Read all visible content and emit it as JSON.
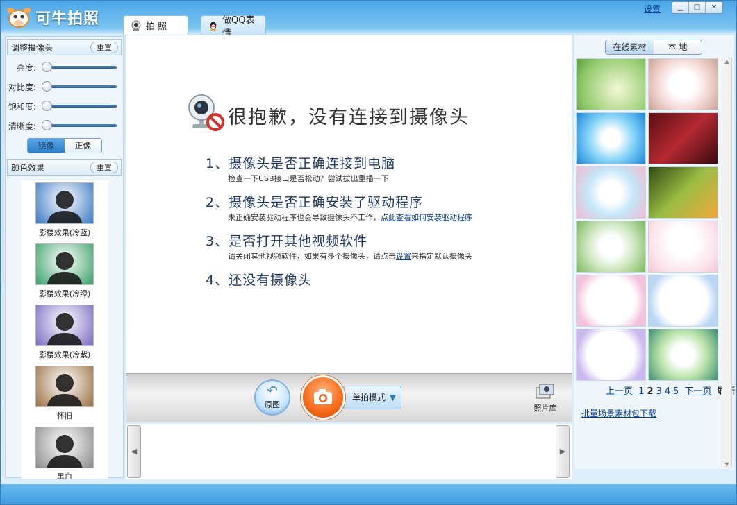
{
  "app": {
    "title": "可牛拍照"
  },
  "tabs": [
    {
      "label": "拍 照"
    },
    {
      "label": "做QQ表情"
    }
  ],
  "header": {
    "settings_link": "设置"
  },
  "camera_panel": {
    "title": "调整摄像头",
    "reset_label": "重置",
    "sliders": [
      {
        "label": "亮度:",
        "level": 0
      },
      {
        "label": "对比度:",
        "level": 0
      },
      {
        "label": "饱和度:",
        "level": 0
      },
      {
        "label": "清晰度:",
        "level": 0
      }
    ],
    "mirror_on": "镜像",
    "mirror_off": "正像"
  },
  "effects_panel": {
    "title": "颜色效果",
    "reset_label": "重置",
    "items": [
      {
        "label": "影楼效果(冷蓝)",
        "color": "#3a79c3"
      },
      {
        "label": "影楼效果(冷绿)",
        "color": "#3aa06a"
      },
      {
        "label": "影楼效果(冷紫)",
        "color": "#7a6bbf"
      },
      {
        "label": "怀旧",
        "color": "#9a7042"
      },
      {
        "label": "黑白",
        "color": "#8c8c8c"
      }
    ]
  },
  "error": {
    "title": "很抱歉，没有连接到摄像头",
    "tips": [
      {
        "head": "1、摄像头是否正确连接到电脑",
        "sub_before": "检查一下USB接口是否松动？尝试拔出重插一下",
        "link": "",
        "sub_after": ""
      },
      {
        "head": "2、摄像头是否正确安装了驱动程序",
        "sub_before": "未正确安装驱动程序也会导致摄像头不工作，",
        "link": "点此查看如何安装驱动程序",
        "sub_after": ""
      },
      {
        "head": "3、是否打开其他视频软件",
        "sub_before": "请关闭其他视频软件，如果有多个摄像头，请点击",
        "link": "设置",
        "sub_after": "来指定默认摄像头"
      },
      {
        "head": "4、还没有摄像头",
        "sub_before": "",
        "link": "",
        "sub_after": ""
      }
    ]
  },
  "toolbar": {
    "original_label": "原图",
    "mode_label": "单拍模式",
    "gallery_label": "照片库"
  },
  "materials_panel": {
    "online_label": "在线素材",
    "local_label": "本 地",
    "pager": {
      "prev": "上一页",
      "pages": [
        "1",
        "2",
        "3",
        "4",
        "5"
      ],
      "current": "2",
      "next": "下一页",
      "refresh": "刷新"
    },
    "batch_link": "批量场景素材包下载"
  }
}
